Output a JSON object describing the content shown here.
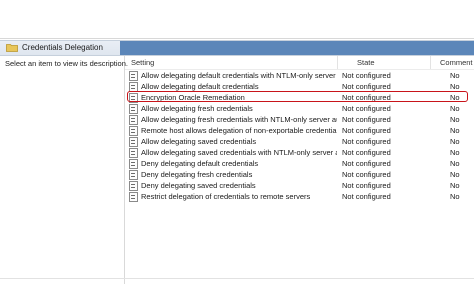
{
  "header": {
    "title": "Credentials Delegation"
  },
  "left_pane": {
    "text": "Select an item to view its description."
  },
  "columns": {
    "setting": "Setting",
    "state": "State",
    "comment": "Comment"
  },
  "rows": [
    {
      "setting": "Allow delegating default credentials with NTLM-only server a...",
      "state": "Not configured",
      "comment": "No"
    },
    {
      "setting": "Allow delegating default credentials",
      "state": "Not configured",
      "comment": "No"
    },
    {
      "setting": "Encryption Oracle Remediation",
      "state": "Not configured",
      "comment": "No",
      "highlighted": true
    },
    {
      "setting": "Allow delegating fresh credentials",
      "state": "Not configured",
      "comment": "No"
    },
    {
      "setting": "Allow delegating fresh credentials with NTLM-only server au...",
      "state": "Not configured",
      "comment": "No"
    },
    {
      "setting": "Remote host allows delegation of non-exportable credentials",
      "state": "Not configured",
      "comment": "No"
    },
    {
      "setting": "Allow delegating saved credentials",
      "state": "Not configured",
      "comment": "No"
    },
    {
      "setting": "Allow delegating saved credentials with NTLM-only server a...",
      "state": "Not configured",
      "comment": "No"
    },
    {
      "setting": "Deny delegating default credentials",
      "state": "Not configured",
      "comment": "No"
    },
    {
      "setting": "Deny delegating fresh credentials",
      "state": "Not configured",
      "comment": "No"
    },
    {
      "setting": "Deny delegating saved credentials",
      "state": "Not configured",
      "comment": "No"
    },
    {
      "setting": "Restrict delegation of credentials to remote servers",
      "state": "Not configured",
      "comment": "No"
    }
  ],
  "icons": {
    "header": "folder-icon",
    "row": "policy-setting-icon"
  },
  "colors": {
    "header_blue": "#5b86b9",
    "highlight": "#c8141a"
  }
}
